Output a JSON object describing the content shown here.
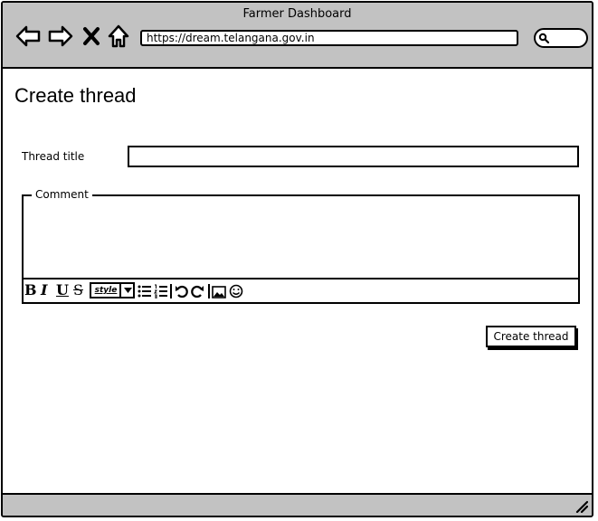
{
  "window": {
    "title": "Farmer Dashboard"
  },
  "browser": {
    "url": "https://dream.telangana.gov.in",
    "nav_icons": [
      "back-arrow-icon",
      "forward-arrow-icon",
      "close-x-icon",
      "home-icon"
    ],
    "search_icon": "magnifier-icon"
  },
  "page": {
    "heading": "Create thread",
    "thread_title": {
      "label": "Thread title",
      "value": ""
    },
    "comment": {
      "legend": "Comment",
      "value": ""
    },
    "toolbar": {
      "bold": "B",
      "italic": "I",
      "underline": "U",
      "strike": "S",
      "style_value": "style",
      "icons": [
        "bullet-list-icon",
        "numbered-list-icon",
        "undo-icon",
        "redo-icon",
        "image-icon",
        "emoji-icon"
      ]
    },
    "submit_label": "Create thread"
  }
}
